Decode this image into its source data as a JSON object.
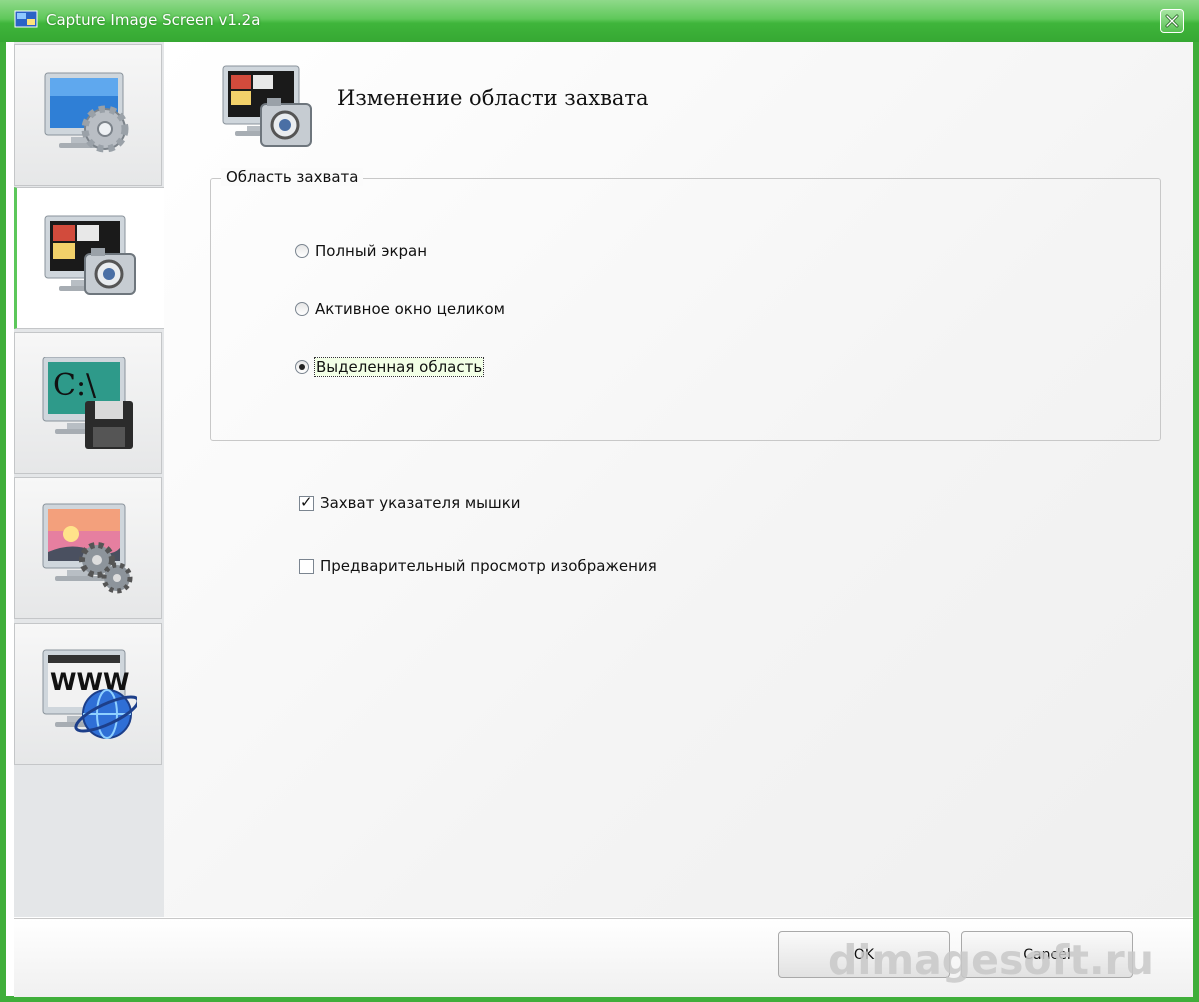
{
  "window": {
    "title": "Capture Image Screen v1.2a"
  },
  "sidebar": {
    "items": [
      {
        "id": "general",
        "icon": "monitor-gear-icon"
      },
      {
        "id": "capture",
        "icon": "monitor-camera-icon"
      },
      {
        "id": "save",
        "icon": "monitor-floppy-icon"
      },
      {
        "id": "image",
        "icon": "picture-gear-icon"
      },
      {
        "id": "web",
        "icon": "www-globe-icon"
      }
    ]
  },
  "main": {
    "title": "Изменение области захвата",
    "group": {
      "legend": "Область захвата",
      "options": [
        {
          "label": "Полный экран",
          "checked": false
        },
        {
          "label": "Активное окно целиком",
          "checked": false
        },
        {
          "label": "Выделенная область",
          "checked": true
        }
      ]
    },
    "checkboxes": [
      {
        "label": "Захват указателя мышки",
        "checked": true
      },
      {
        "label": "Предварительный просмотр изображения",
        "checked": false
      }
    ]
  },
  "footer": {
    "ok_label": "OK",
    "cancel_label": "Cancel"
  },
  "watermark": "dimagesoft.ru",
  "colors": {
    "title_green": "#4cbb47",
    "accent": "#5cc75a"
  }
}
